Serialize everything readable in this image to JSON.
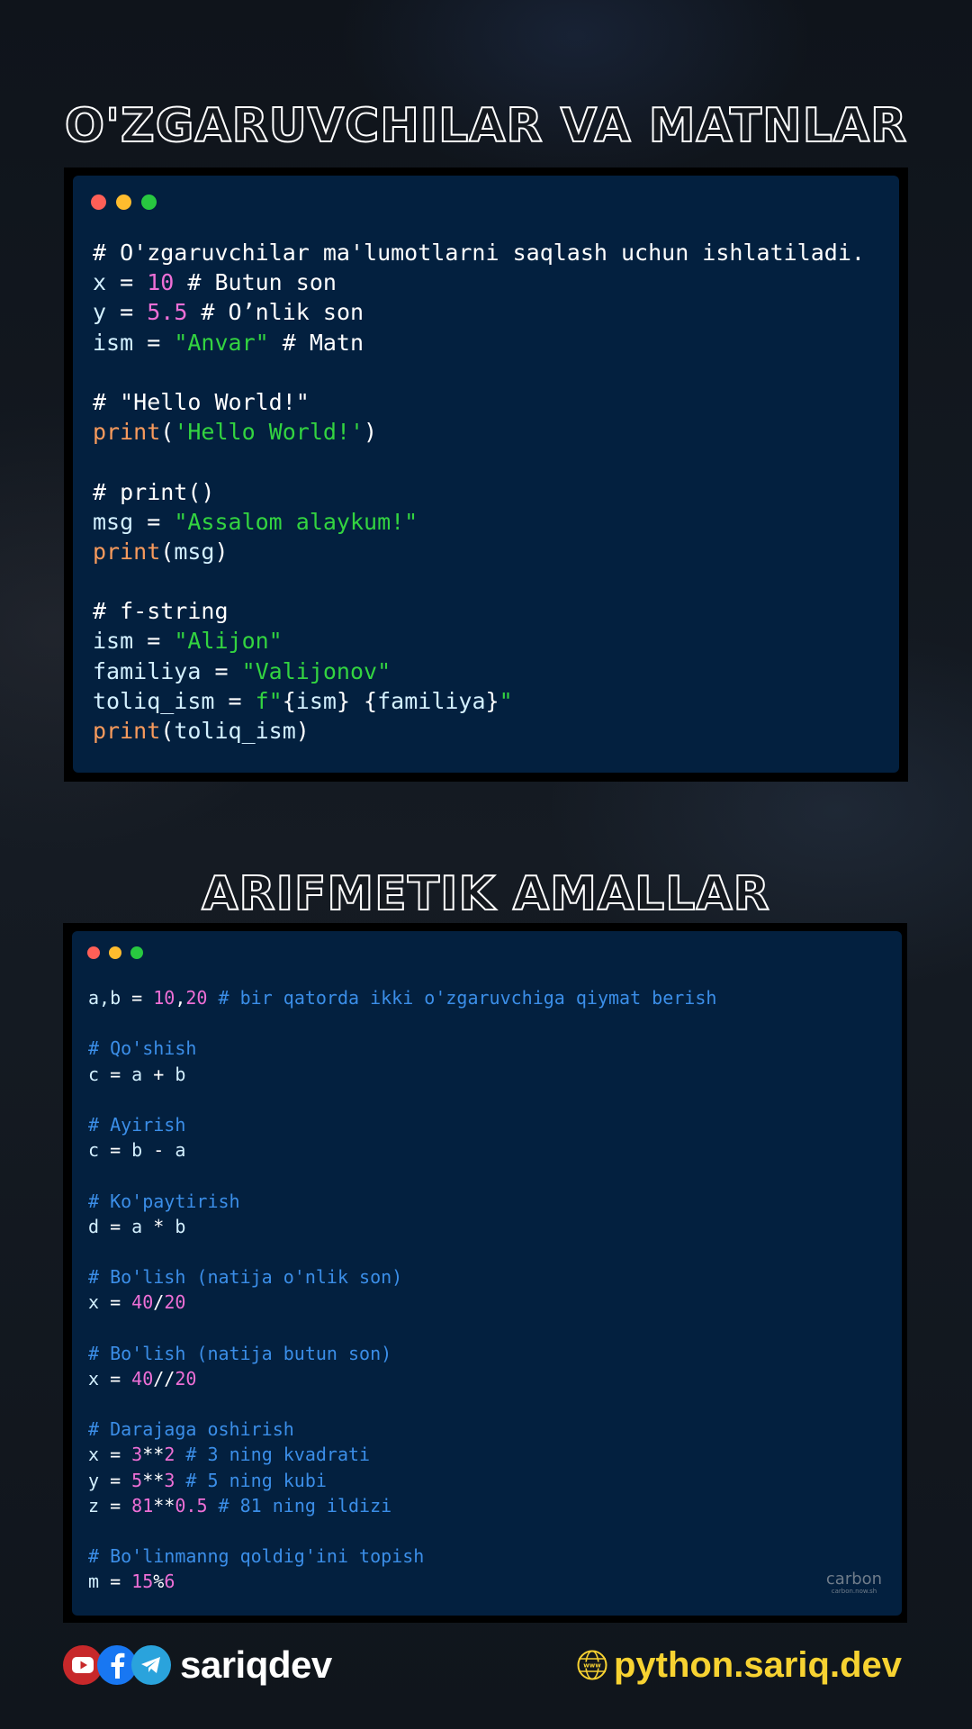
{
  "section1": {
    "title": "O'ZGARUVCHILAR VA MATNLAR",
    "code": [
      [
        [
          "cm1",
          "# O'zgaruvchilar ma'lumotlarni saqlash uchun ishlatiladi."
        ]
      ],
      [
        [
          "var",
          "x"
        ],
        [
          "pl",
          " = "
        ],
        [
          "num",
          "10"
        ],
        [
          "cm1",
          " # Butun son"
        ]
      ],
      [
        [
          "var",
          "y"
        ],
        [
          "pl",
          " = "
        ],
        [
          "num",
          "5.5"
        ],
        [
          "cm1",
          " # O’nlik son"
        ]
      ],
      [
        [
          "var",
          "ism"
        ],
        [
          "pl",
          " = "
        ],
        [
          "str",
          "\"Anvar\""
        ],
        [
          "cm1",
          " # Matn"
        ]
      ],
      [],
      [
        [
          "cm1",
          "# \"Hello World!\""
        ]
      ],
      [
        [
          "fn",
          "print"
        ],
        [
          "pl",
          "("
        ],
        [
          "str",
          "'Hello World!'"
        ],
        [
          "pl",
          ")"
        ]
      ],
      [],
      [
        [
          "cm1",
          "# print()"
        ]
      ],
      [
        [
          "var",
          "msg"
        ],
        [
          "pl",
          " = "
        ],
        [
          "str",
          "\"Assalom alaykum!\""
        ]
      ],
      [
        [
          "fn",
          "print"
        ],
        [
          "pl",
          "("
        ],
        [
          "var",
          "msg"
        ],
        [
          "pl",
          ")"
        ]
      ],
      [],
      [
        [
          "cm1",
          "# f-string"
        ]
      ],
      [
        [
          "var",
          "ism"
        ],
        [
          "pl",
          " = "
        ],
        [
          "str",
          "\"Alijon\""
        ]
      ],
      [
        [
          "var",
          "familiya"
        ],
        [
          "pl",
          " = "
        ],
        [
          "str",
          "\"Valijonov\""
        ]
      ],
      [
        [
          "var",
          "toliq_ism"
        ],
        [
          "pl",
          " = "
        ],
        [
          "str",
          "f\""
        ],
        [
          "pl",
          "{"
        ],
        [
          "var",
          "ism"
        ],
        [
          "pl",
          "} {"
        ],
        [
          "var",
          "familiya"
        ],
        [
          "pl",
          "}"
        ],
        [
          "str",
          "\""
        ]
      ],
      [
        [
          "fn",
          "print"
        ],
        [
          "pl",
          "("
        ],
        [
          "var",
          "toliq_ism"
        ],
        [
          "pl",
          ")"
        ]
      ]
    ]
  },
  "section2": {
    "title": "ARIFMETIK AMALLAR",
    "code": [
      [
        [
          "var",
          "a,b"
        ],
        [
          "pl",
          " = "
        ],
        [
          "num",
          "10"
        ],
        [
          "pl",
          ","
        ],
        [
          "num",
          "20"
        ],
        [
          "cm2",
          " # bir qatorda ikki o'zgaruvchiga qiymat berish"
        ]
      ],
      [],
      [
        [
          "cm2",
          "# Qo'shish"
        ]
      ],
      [
        [
          "var",
          "c"
        ],
        [
          "pl",
          " = "
        ],
        [
          "var",
          "a"
        ],
        [
          "pl",
          " + "
        ],
        [
          "var",
          "b"
        ]
      ],
      [],
      [
        [
          "cm2",
          "# Ayirish"
        ]
      ],
      [
        [
          "var",
          "c"
        ],
        [
          "pl",
          " = "
        ],
        [
          "var",
          "b"
        ],
        [
          "pl",
          " - "
        ],
        [
          "var",
          "a"
        ]
      ],
      [],
      [
        [
          "cm2",
          "# Ko'paytirish"
        ]
      ],
      [
        [
          "var",
          "d"
        ],
        [
          "pl",
          " = "
        ],
        [
          "var",
          "a"
        ],
        [
          "pl",
          " * "
        ],
        [
          "var",
          "b"
        ]
      ],
      [],
      [
        [
          "cm2",
          "# Bo'lish (natija o'nlik son)"
        ]
      ],
      [
        [
          "var",
          "x"
        ],
        [
          "pl",
          " = "
        ],
        [
          "num",
          "40"
        ],
        [
          "pl",
          "/"
        ],
        [
          "num",
          "20"
        ]
      ],
      [],
      [
        [
          "cm2",
          "# Bo'lish (natija butun son)"
        ]
      ],
      [
        [
          "var",
          "x"
        ],
        [
          "pl",
          " = "
        ],
        [
          "num",
          "40"
        ],
        [
          "pl",
          "//"
        ],
        [
          "num",
          "20"
        ]
      ],
      [],
      [
        [
          "cm2",
          "# Darajaga oshirish"
        ]
      ],
      [
        [
          "var",
          "x"
        ],
        [
          "pl",
          " = "
        ],
        [
          "num",
          "3"
        ],
        [
          "pl",
          "**"
        ],
        [
          "num",
          "2"
        ],
        [
          "cm2",
          " # 3 ning kvadrati"
        ]
      ],
      [
        [
          "var",
          "y"
        ],
        [
          "pl",
          " = "
        ],
        [
          "num",
          "5"
        ],
        [
          "pl",
          "**"
        ],
        [
          "num",
          "3"
        ],
        [
          "cm2",
          " # 5 ning kubi"
        ]
      ],
      [
        [
          "var",
          "z"
        ],
        [
          "pl",
          " = "
        ],
        [
          "num",
          "81"
        ],
        [
          "pl",
          "**"
        ],
        [
          "num",
          "0.5"
        ],
        [
          "cm2",
          " # 81 ning ildizi"
        ]
      ],
      [],
      [
        [
          "cm2",
          "# Bo'linmanng qoldig'ini topish"
        ]
      ],
      [
        [
          "var",
          "m"
        ],
        [
          "pl",
          " = "
        ],
        [
          "num",
          "15"
        ],
        [
          "pl",
          "%"
        ],
        [
          "num",
          "6"
        ]
      ]
    ],
    "watermark_logo": "carbon",
    "watermark_url": "carbon.now.sh"
  },
  "footer": {
    "brand": "sariqdev",
    "website": "python.sariq.dev",
    "icons": [
      "youtube-icon",
      "facebook-icon",
      "telegram-icon",
      "globe-icon"
    ]
  },
  "colors": {
    "window_bg": "#03203f",
    "comment_white": "#ffffff",
    "comment_blue": "#3b8ee8",
    "number": "#ee6fd6",
    "string": "#33d440",
    "function": "#f79a5c",
    "website_yellow": "#f7d231"
  }
}
